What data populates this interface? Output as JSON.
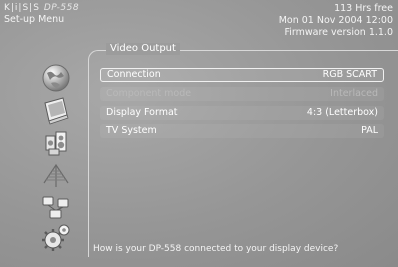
{
  "brand": {
    "logo": "K|i|S|S",
    "model": "DP-558"
  },
  "menu_title": "Set-up Menu",
  "status": {
    "hdd_free": "113 Hrs free",
    "datetime": "Mon 01 Nov 2004 12:00",
    "firmware": "Firmware version 1.1.0"
  },
  "categories": [
    {
      "icon": "globe-icon"
    },
    {
      "icon": "display-screen-icon"
    },
    {
      "icon": "audio-speakers-icon"
    },
    {
      "icon": "antenna-icon"
    },
    {
      "icon": "network-icon"
    },
    {
      "icon": "gears-icon"
    }
  ],
  "panel": {
    "title": "Video Output",
    "rows": [
      {
        "label": "Connection",
        "value": "RGB SCART",
        "state": "selected"
      },
      {
        "label": "Component mode",
        "value": "Interlaced",
        "state": "disabled"
      },
      {
        "label": "Display Format",
        "value": "4:3 (Letterbox)",
        "state": "normal"
      },
      {
        "label": "TV System",
        "value": "PAL",
        "state": "normal"
      }
    ]
  },
  "help_text": "How is your DP-558 connected to your display device?",
  "colors": {
    "background": "#9a9a9a",
    "text": "#ffffff",
    "disabled_text": "#b9b9b9"
  }
}
